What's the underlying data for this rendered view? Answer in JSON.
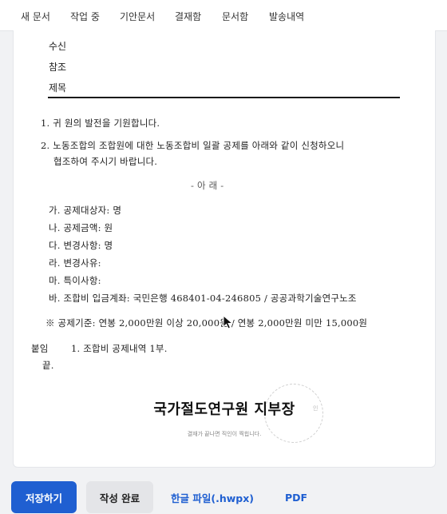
{
  "nav": {
    "tabs": [
      "새 문서",
      "작업 중",
      "기안문서",
      "결재함",
      "문서함",
      "발송내역"
    ]
  },
  "document": {
    "header": {
      "recipient_label": "수신",
      "reference_label": "참조",
      "subject_label": "제목"
    },
    "para1": "1. 귀 원의 발전을 기원합니다.",
    "para2_line1": "2.      노동조합의 조합원에 대한    노동조합비 일괄 공제를 아래와 같이 신청하오니",
    "para2_line2": "협조하여 주시기 바랍니다.",
    "below_heading": "- 아  래 -",
    "items": [
      "가. 공제대상자:    명",
      "나. 공제금액:    원",
      "다. 변경사항:    명",
      "라. 변경사유:",
      "마. 특이사항:",
      "바. 조합비 입금계좌: 국민은행 468401-04-246805 / 공공과학기술연구노조"
    ],
    "deduction_standard": "※ 공제기준: 연봉 2,000만원 이상 20,000원 / 연봉 2,000만원 미만 15,000원",
    "attachment_label": "붙임",
    "attachment_text": "1.      조합비 공제내역 1부.",
    "end_mark": "끝.",
    "signer": "국가절도연구원 지부장",
    "stamp_label": "인",
    "sign_note": "결재가 끝나면 직인이 찍힙니다."
  },
  "actions": {
    "save": "저장하기",
    "complete": "작성 완료",
    "hwpx": "한글 파일(.hwpx)",
    "pdf": "PDF"
  },
  "colors": {
    "accent": "#1f5fd1",
    "background": "#f1f2f4",
    "complete_button": "#e4e5e8"
  }
}
